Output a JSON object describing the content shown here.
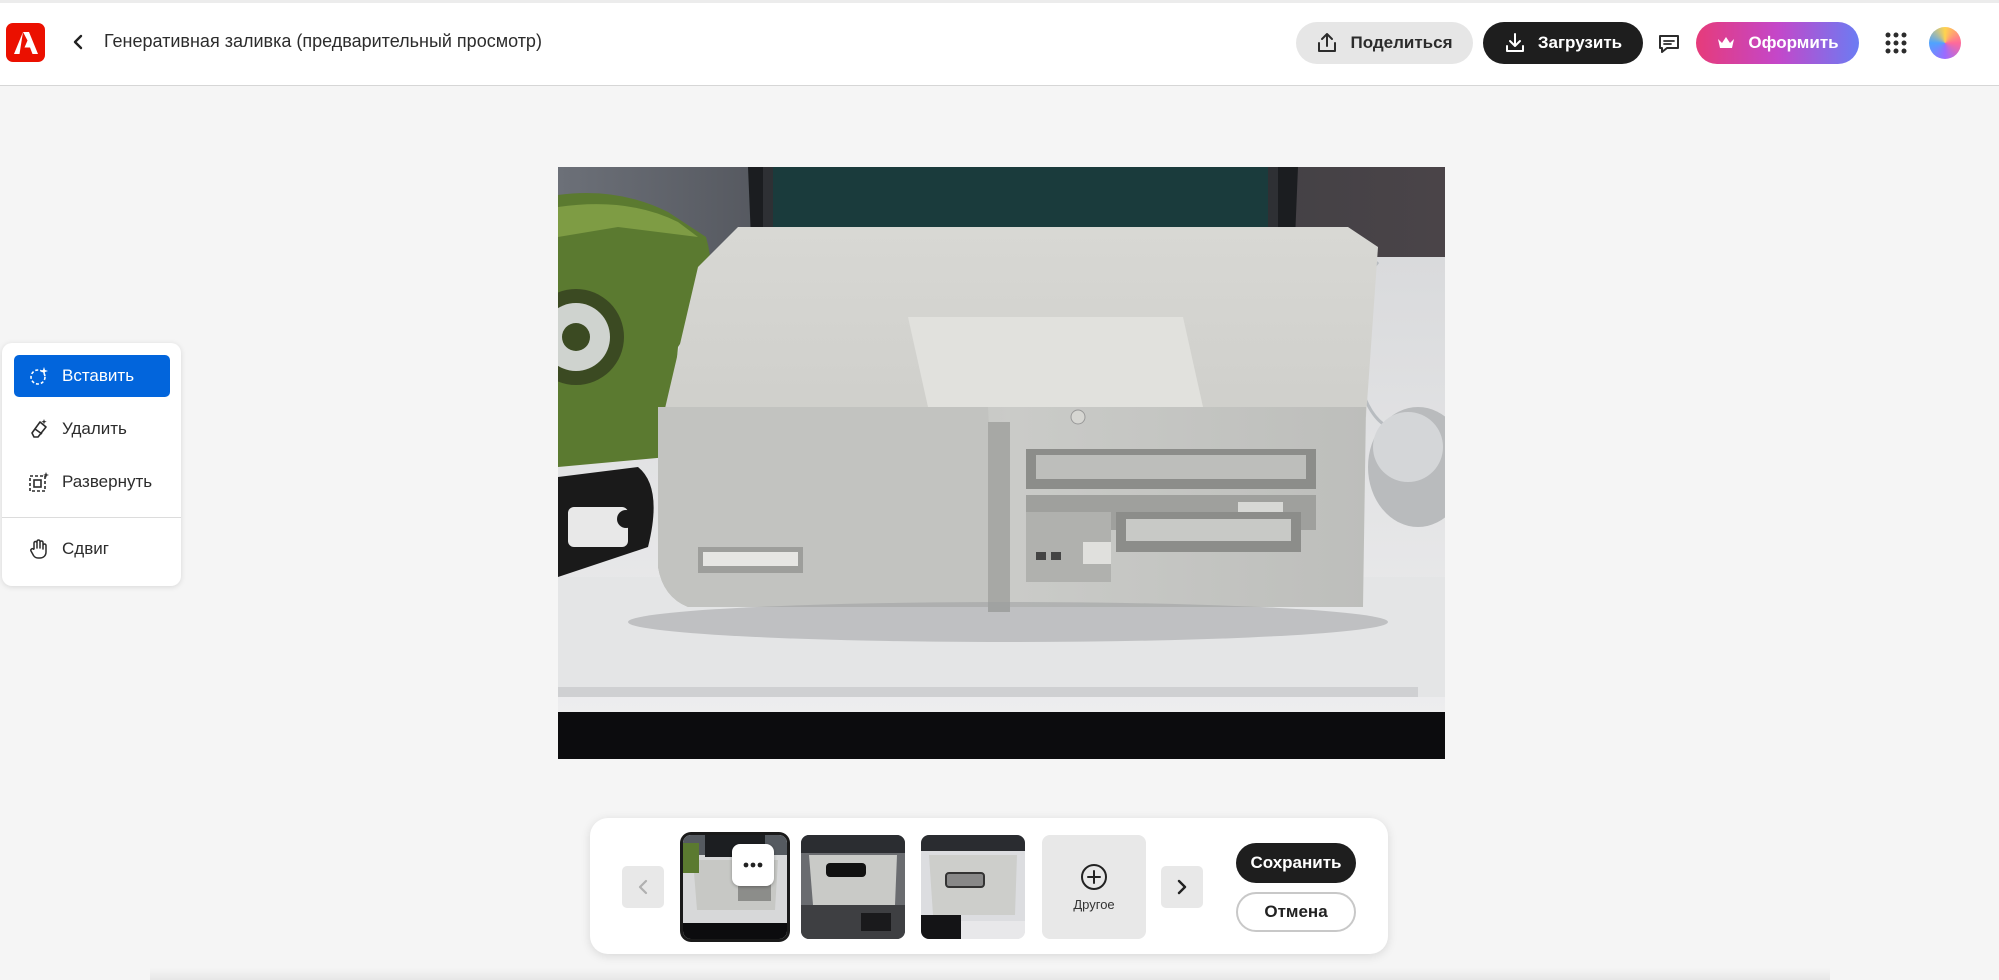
{
  "header": {
    "title": "Генеративная заливка (предварительный просмотр)",
    "share_label": "Поделиться",
    "download_label": "Загрузить",
    "premium_label": "Оформить",
    "colors": {
      "brand_red": "#eb1000",
      "download_bg": "#1e1e1e"
    }
  },
  "tools": {
    "items": [
      {
        "label": "Вставить",
        "icon": "generative-insert-icon",
        "active": true
      },
      {
        "label": "Удалить",
        "icon": "eraser-icon",
        "active": false
      },
      {
        "label": "Развернуть",
        "icon": "expand-icon",
        "active": false
      },
      {
        "label": "Сдвиг",
        "icon": "hand-icon",
        "active": false
      }
    ],
    "active_color": "#0265dc"
  },
  "canvas": {
    "description_icon": "image-canvas"
  },
  "tray": {
    "other_label": "Другое",
    "save_label": "Сохранить",
    "cancel_label": "Отмена",
    "selected_variation": 1,
    "variation_count": 3
  }
}
